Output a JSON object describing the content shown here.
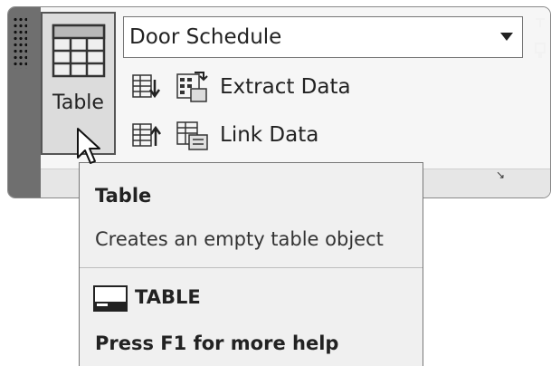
{
  "ribbon_panel": {
    "table_button": {
      "label": "Table",
      "icon": "table-grid-icon"
    },
    "style_dropdown": {
      "selected": "Door Schedule",
      "icon": "chevron-down-icon"
    },
    "actions": [
      {
        "icon_left": "extract-data-from-table-icon",
        "icon_right": "data-extraction-icon",
        "label": "Extract Data"
      },
      {
        "icon_left": "upload-data-to-table-icon",
        "icon_right": "data-link-icon",
        "label": "Link Data"
      }
    ],
    "dialog_launcher_glyph": "↘"
  },
  "tooltip": {
    "title": "Table",
    "description": "Creates an empty table object",
    "command": "TABLE",
    "help": "Press F1 for more help"
  }
}
